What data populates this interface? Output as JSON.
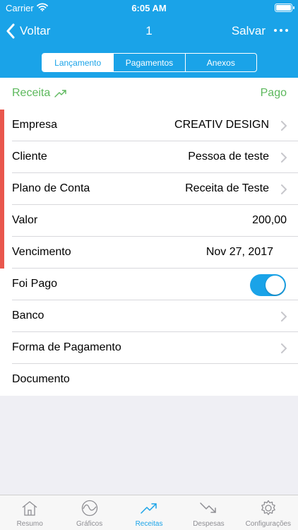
{
  "status_bar": {
    "carrier": "Carrier",
    "time": "6:05 AM"
  },
  "nav": {
    "back_label": "Voltar",
    "title": "1",
    "save_label": "Salvar"
  },
  "segments": [
    "Lançamento",
    "Pagamentos",
    "Anexos"
  ],
  "selected_segment": "Lançamento",
  "header": {
    "type": "Receita",
    "status": "Pago"
  },
  "rows": {
    "empresa": {
      "label": "Empresa",
      "value": "CREATIV DESIGN"
    },
    "cliente": {
      "label": "Cliente",
      "value": "Pessoa de teste"
    },
    "plano": {
      "label": "Plano de Conta",
      "value": "Receita de Teste"
    },
    "valor": {
      "label": "Valor",
      "value": "200,00"
    },
    "vencimento": {
      "label": "Vencimento",
      "value": "Nov 27, 2017"
    },
    "foi_pago": {
      "label": "Foi Pago",
      "toggle_on": true
    },
    "banco": {
      "label": "Banco",
      "value": ""
    },
    "forma_pagamento": {
      "label": "Forma de Pagamento",
      "value": ""
    },
    "documento": {
      "label": "Documento",
      "value": ""
    }
  },
  "tabs": {
    "resumo": "Resumo",
    "graficos": "Gráficos",
    "receitas": "Receitas",
    "despesas": "Despesas",
    "configuracoes": "Configurações"
  },
  "active_tab": "Receitas",
  "colors": {
    "primary": "#1aa3e8",
    "income_green": "#5cb85c",
    "accent_red": "#e9574d",
    "inactive_gray": "#8e8e93"
  }
}
